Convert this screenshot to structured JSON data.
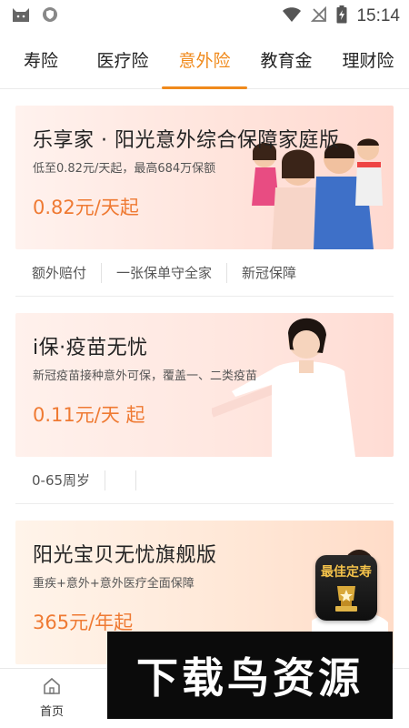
{
  "status_bar": {
    "time": "15:14",
    "icons": [
      "cat-app-icon",
      "shield-icon",
      "wifi-icon",
      "no-signal-icon",
      "battery-charging-icon"
    ]
  },
  "tabs": [
    {
      "label": "寿险",
      "active": false
    },
    {
      "label": "医疗险",
      "active": false
    },
    {
      "label": "意外险",
      "active": true
    },
    {
      "label": "教育金",
      "active": false
    },
    {
      "label": "理财险",
      "active": false
    }
  ],
  "accent_color": "#f08a1c",
  "price_color": "#ef7a33",
  "cards": [
    {
      "title": "乐享家 · 阳光意外综合保障家庭版",
      "subtitle": "低至0.82元/天起，最高684万保额",
      "price": "0.82元/天起",
      "tags": [
        "额外赔付",
        "一张保单守全家",
        "新冠保障"
      ],
      "illustration": "family-photo"
    },
    {
      "title": "i保·疫苗无忧",
      "subtitle": "新冠疫苗接种意外可保，覆盖一、二类疫苗",
      "price": "0.11元/天 起",
      "tags": [
        "0-65周岁"
      ],
      "illustration": "nurse-photo"
    },
    {
      "title": "阳光宝贝无忧旗舰版",
      "subtitle": "重疾+意外+意外医疗全面保障",
      "price": "365元/年起",
      "badge": "最佳定寿",
      "illustration": "baby-photo"
    }
  ],
  "bottom_nav": {
    "home_label": "首页"
  },
  "watermark": "下载鸟资源"
}
